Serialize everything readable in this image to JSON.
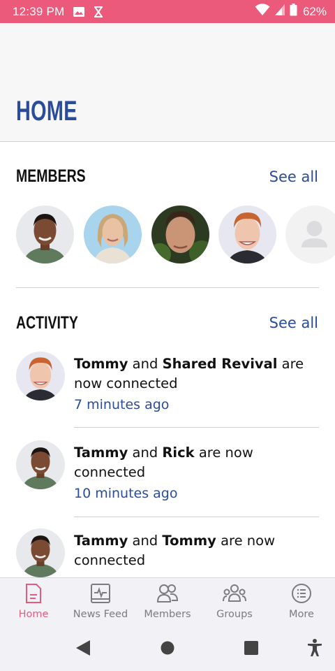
{
  "status_bar": {
    "time": "12:39 PM",
    "battery": "62%"
  },
  "header": {
    "title": "HOME"
  },
  "members": {
    "title": "MEMBERS",
    "see_all": "See all",
    "avatars": [
      "member-woman-1",
      "member-woman-2",
      "member-man-1",
      "member-man-2",
      "member-placeholder"
    ]
  },
  "activity": {
    "title": "ACTIVITY",
    "see_all": "See all",
    "items": [
      {
        "name1": "Tommy",
        "connector": "and",
        "name2": "Shared Revival",
        "suffix": "are now connected",
        "time": "7 minutes ago"
      },
      {
        "name1": "Tammy",
        "connector": "and",
        "name2": "Rick",
        "suffix": "are now connected",
        "time": "10 minutes ago"
      },
      {
        "name1": "Tammy",
        "connector": "and",
        "name2": "Tommy",
        "suffix": "are now connected",
        "time": ""
      }
    ]
  },
  "bottom_nav": {
    "items": [
      {
        "label": "Home",
        "icon": "document-icon",
        "active": true
      },
      {
        "label": "News Feed",
        "icon": "pulse-icon",
        "active": false
      },
      {
        "label": "Members",
        "icon": "members-icon",
        "active": false
      },
      {
        "label": "Groups",
        "icon": "groups-icon",
        "active": false
      },
      {
        "label": "More",
        "icon": "list-icon",
        "active": false
      }
    ]
  },
  "colors": {
    "status_bar": "#ec5a7b",
    "accent": "#2a4c9b",
    "active_nav": "#e85a7d"
  }
}
